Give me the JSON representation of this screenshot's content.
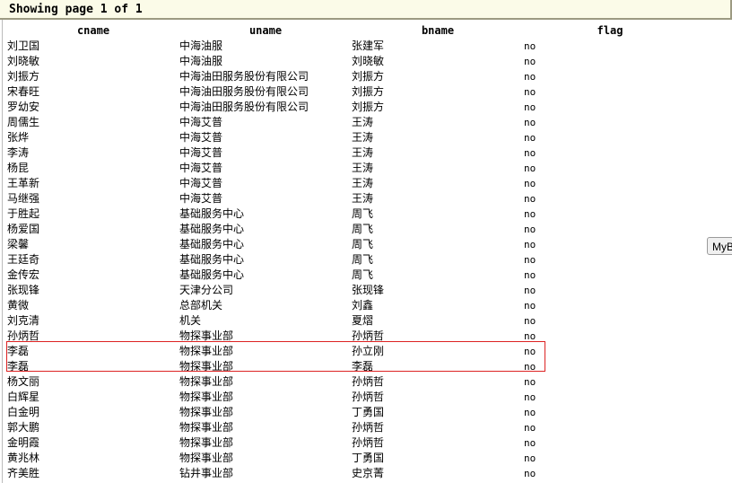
{
  "header": {
    "title": "Showing page  1  of  1"
  },
  "columns": [
    "cname",
    "uname",
    "bname",
    "flag"
  ],
  "rows": [
    [
      "刘卫国",
      "中海油服",
      "张建军",
      "no"
    ],
    [
      "刘晓敏",
      "中海油服",
      "刘晓敏",
      "no"
    ],
    [
      "刘振方",
      "中海油田服务股份有限公司",
      "刘振方",
      "no"
    ],
    [
      "宋春旺",
      "中海油田服务股份有限公司",
      "刘振方",
      "no"
    ],
    [
      "罗幼安",
      "中海油田服务股份有限公司",
      "刘振方",
      "no"
    ],
    [
      "周儒生",
      "中海艾普",
      "王涛",
      "no"
    ],
    [
      "张烨",
      "中海艾普",
      "王涛",
      "no"
    ],
    [
      "李涛",
      "中海艾普",
      "王涛",
      "no"
    ],
    [
      "杨昆",
      "中海艾普",
      "王涛",
      "no"
    ],
    [
      "王革新",
      "中海艾普",
      "王涛",
      "no"
    ],
    [
      "马继强",
      "中海艾普",
      "王涛",
      "no"
    ],
    [
      "于胜起",
      "基础服务中心",
      "周飞",
      "no"
    ],
    [
      "杨爱国",
      "基础服务中心",
      "周飞",
      "no"
    ],
    [
      "梁馨",
      "基础服务中心",
      "周飞",
      "no"
    ],
    [
      "王廷奇",
      "基础服务中心",
      "周飞",
      "no"
    ],
    [
      "金传宏",
      "基础服务中心",
      "周飞",
      "no"
    ],
    [
      "张现锋",
      "天津分公司",
      "张现锋",
      "no"
    ],
    [
      "黄微",
      "总部机关",
      "刘鑫",
      "no"
    ],
    [
      "刘克清",
      "机关",
      "夏熠",
      "no"
    ],
    [
      "孙炳哲",
      "物探事业部",
      "孙炳哲",
      "no"
    ],
    [
      "李磊",
      "物探事业部",
      "孙立刚",
      "no"
    ],
    [
      "李磊",
      "物探事业部",
      "李磊",
      "no"
    ],
    [
      "杨文丽",
      "物探事业部",
      "孙炳哲",
      "no"
    ],
    [
      "白辉星",
      "物探事业部",
      "孙炳哲",
      "no"
    ],
    [
      "白金明",
      "物探事业部",
      "丁勇国",
      "no"
    ],
    [
      "郭大鹏",
      "物探事业部",
      "孙炳哲",
      "no"
    ],
    [
      "金明霞",
      "物探事业部",
      "孙炳哲",
      "no"
    ],
    [
      "黄兆林",
      "物探事业部",
      "丁勇国",
      "no"
    ],
    [
      "齐美胜",
      "钻井事业部",
      "史京菁",
      "no"
    ]
  ],
  "side_button": {
    "label": "MyB"
  }
}
